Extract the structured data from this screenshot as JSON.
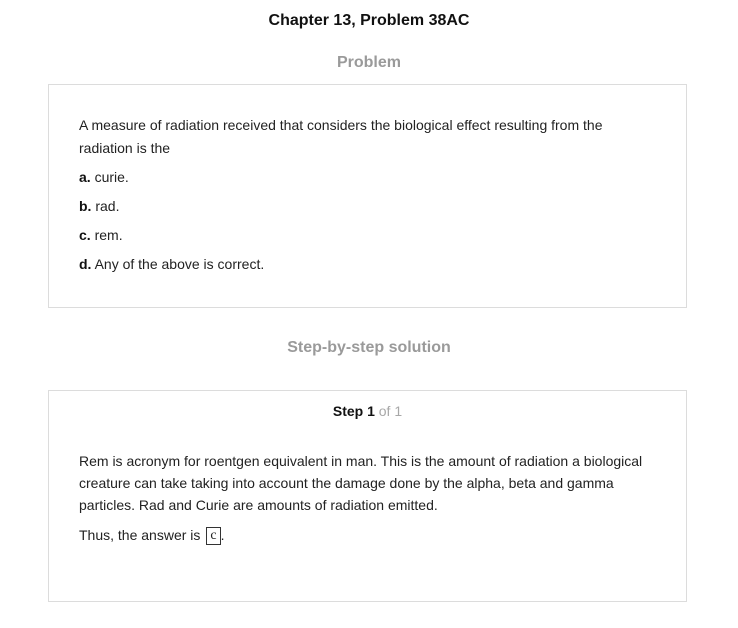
{
  "header": {
    "title": "Chapter 13, Problem 38AC"
  },
  "problem": {
    "heading": "Problem",
    "question": "A measure of radiation received that considers the biological effect resulting from the radiation is the",
    "options": [
      {
        "letter": "a.",
        "text": "curie."
      },
      {
        "letter": "b.",
        "text": "rad."
      },
      {
        "letter": "c.",
        "text": "rem."
      },
      {
        "letter": "d.",
        "text": "Any of the above is correct."
      }
    ]
  },
  "solution": {
    "heading": "Step-by-step solution",
    "step_label": "Step 1",
    "step_of": "of 1",
    "text": "Rem is acronym for roentgen equivalent in man. This is the amount of radiation a biological creature can take taking into account the damage done by the alpha, beta and gamma particles. Rad and Curie are amounts of radiation emitted.",
    "answer_prefix": "Thus, the answer is",
    "answer": "c",
    "answer_suffix": "."
  }
}
